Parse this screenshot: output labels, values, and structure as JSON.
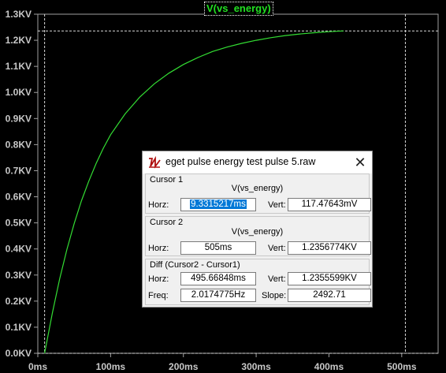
{
  "chart_data": {
    "type": "line",
    "title": "V(vs_energy)",
    "xlabel": "",
    "ylabel": "",
    "xlim": [
      0,
      550
    ],
    "ylim": [
      0,
      1300
    ],
    "x_ticks": [
      "0ms",
      "100ms",
      "200ms",
      "300ms",
      "400ms",
      "500ms"
    ],
    "x_tick_values": [
      0,
      100,
      200,
      300,
      400,
      500
    ],
    "y_ticks": [
      "0.0KV",
      "0.1KV",
      "0.2KV",
      "0.3KV",
      "0.4KV",
      "0.5KV",
      "0.6KV",
      "0.7KV",
      "0.8KV",
      "0.9KV",
      "1.0KV",
      "1.1KV",
      "1.2KV",
      "1.3KV"
    ],
    "y_tick_values": [
      0,
      100,
      200,
      300,
      400,
      500,
      600,
      700,
      800,
      900,
      1000,
      1100,
      1200,
      1300
    ],
    "grid": false,
    "series": [
      {
        "name": "V(vs_energy)",
        "color": "#33dd33",
        "x": [
          9.33,
          20,
          30,
          40,
          50,
          60,
          70,
          80,
          90,
          100,
          120,
          140,
          160,
          180,
          200,
          220,
          240,
          260,
          280,
          300,
          320,
          340,
          360,
          380,
          400,
          420
        ],
        "y": [
          0,
          155,
          285,
          398,
          498,
          585,
          660,
          727,
          786,
          838,
          918,
          982,
          1033,
          1074,
          1107,
          1134,
          1157,
          1174,
          1188,
          1200,
          1210,
          1218,
          1224,
          1229,
          1233,
          1236
        ]
      }
    ],
    "cursors": [
      {
        "name": "Cursor 1",
        "x": 9.33,
        "y": 0.117
      },
      {
        "name": "Cursor 2",
        "x": 505,
        "y": 1235.7
      }
    ]
  },
  "dialog": {
    "title": "eget pulse energy test pulse 5.raw",
    "icon": "ltspice-icon",
    "close_glyph": "✕",
    "cursor1": {
      "label": "Cursor 1",
      "trace": "V(vs_energy)",
      "horz_label": "Horz:",
      "horz": "9.3315217ms",
      "vert_label": "Vert:",
      "vert": "117.47643mV"
    },
    "cursor2": {
      "label": "Cursor 2",
      "trace": "V(vs_energy)",
      "horz_label": "Horz:",
      "horz": "505ms",
      "vert_label": "Vert:",
      "vert": "1.2356774KV"
    },
    "diff": {
      "label": "Diff (Cursor2 - Cursor1)",
      "horz_label": "Horz:",
      "horz": "495.66848ms",
      "vert_label": "Vert:",
      "vert": "1.2355599KV",
      "freq_label": "Freq:",
      "freq": "2.0174775Hz",
      "slope_label": "Slope:",
      "slope": "2492.71"
    }
  }
}
